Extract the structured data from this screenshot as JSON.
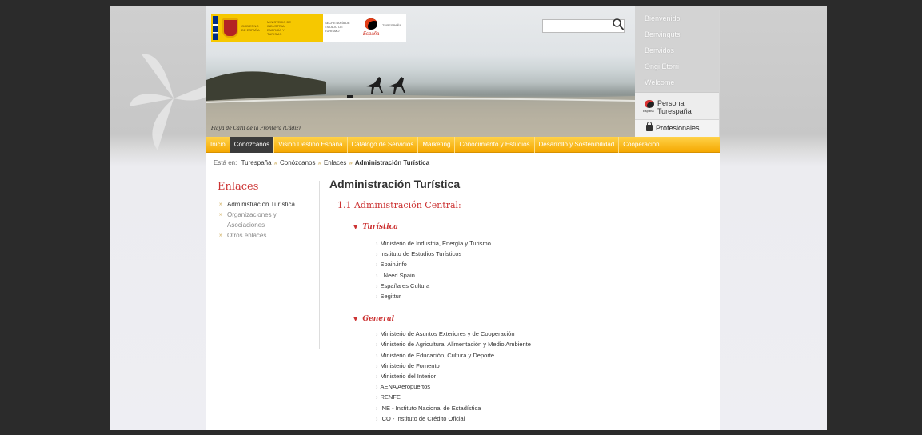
{
  "header": {
    "gov_logo_text": "GOBIERNO DE ESPAÑA",
    "ministry_text": "MINISTERIO DE INDUSTRIA, ENERGÍA Y TURISMO",
    "secretary_text": "SECRETARÍA DE ESTADO DE TURISMO",
    "turespana_logo_text": "TURESPAÑA",
    "photo_caption": "Playa de Caril de la Frontera (Cádiz)",
    "search_placeholder": ""
  },
  "languages": [
    "Bienvenido",
    "Benvinguts",
    "Benvidos",
    "Ongi Etorri",
    "Welcome"
  ],
  "personal_turespana": {
    "line1": "Personal",
    "line2": "Turespaña",
    "logo_sig": "España"
  },
  "profesionales": "Profesionales",
  "nav": [
    {
      "label": "Inicio",
      "active": false
    },
    {
      "label": "Conózcanos",
      "active": true
    },
    {
      "label": "Visión Destino España",
      "active": false
    },
    {
      "label": "Catálogo de Servicios",
      "active": false
    },
    {
      "label": "Marketing",
      "active": false
    },
    {
      "label": "Conocimiento y Estudios",
      "active": false
    },
    {
      "label": "Desarrollo y Sostenibilidad",
      "active": false
    },
    {
      "label": "Cooperación",
      "active": false
    }
  ],
  "breadcrumb": {
    "prefix": "Está en:",
    "items": [
      "Turespaña",
      "Conózcanos",
      "Enlaces"
    ],
    "current": "Administración Turística",
    "separator": "»"
  },
  "sidebar": {
    "title": "Enlaces",
    "items": [
      {
        "label": "Administración Turística",
        "active": true
      },
      {
        "label": "Organizaciones y Asociaciones",
        "active": false
      },
      {
        "label": "Otros enlaces",
        "active": false
      }
    ]
  },
  "main": {
    "title": "Administración Turística",
    "section": "1.1 Administración Central:",
    "groups": [
      {
        "title": "Turística",
        "links": [
          "Ministerio de Industria, Energía y Turismo",
          "Instituto de Estudios Turísticos",
          "Spain.info",
          "I Need Spain",
          "España es Cultura",
          "Segittur"
        ]
      },
      {
        "title": "General",
        "links": [
          "Ministerio de Asuntos Exteriores y de Cooperación",
          "Ministerio de Agricultura, Alimentación y Medio Ambiente",
          "Ministerio de Educación, Cultura y Deporte",
          "Ministerio de Fomento",
          "Ministerio del Interior",
          "AENA Aeropuertos",
          "RENFE",
          "INE - Instituto Nacional de Estadística",
          "ICO - Instituto de Crédito Oficial"
        ]
      }
    ]
  },
  "colors": {
    "nav_orange": "#f5a800",
    "accent_red": "#cc3333",
    "active_nav": "#3b3b3b"
  }
}
